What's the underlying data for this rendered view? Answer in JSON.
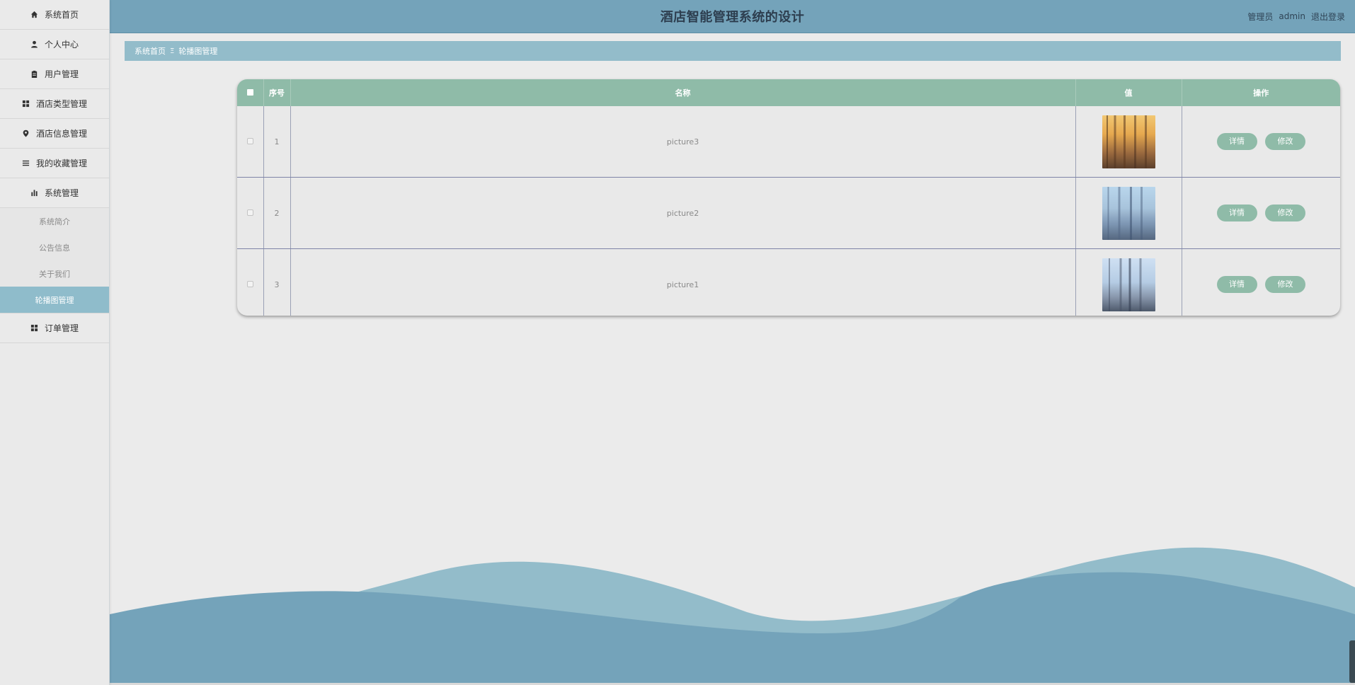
{
  "header": {
    "title": "酒店智能管理系统的设计",
    "user_role": "管理员",
    "username": "admin",
    "logout": "退出登录"
  },
  "sidebar": {
    "items": [
      {
        "label": "系统首页",
        "icon": "home-icon"
      },
      {
        "label": "个人中心",
        "icon": "user-icon"
      },
      {
        "label": "用户管理",
        "icon": "clipboard-icon"
      },
      {
        "label": "酒店类型管理",
        "icon": "grid-icon"
      },
      {
        "label": "酒店信息管理",
        "icon": "location-icon"
      },
      {
        "label": "我的收藏管理",
        "icon": "list-icon"
      },
      {
        "label": "系统管理",
        "icon": "bar-chart-icon"
      }
    ],
    "sub_items": [
      {
        "label": "系统简介"
      },
      {
        "label": "公告信息"
      },
      {
        "label": "关于我们"
      },
      {
        "label": "轮播图管理",
        "active": true
      }
    ],
    "last_item": {
      "label": "订单管理",
      "icon": "grid-icon"
    }
  },
  "breadcrumb": {
    "home": "系统首页",
    "separator": "Ξ",
    "current": "轮播图管理"
  },
  "table": {
    "columns": [
      "序号",
      "名称",
      "值",
      "操作"
    ],
    "rows": [
      {
        "index": "1",
        "name": "picture3",
        "thumb": "city-sunset"
      },
      {
        "index": "2",
        "name": "picture2",
        "thumb": "city-blue"
      },
      {
        "index": "3",
        "name": "picture1",
        "thumb": "city-skyline"
      }
    ],
    "actions": {
      "detail": "详情",
      "edit": "修改"
    }
  },
  "colors": {
    "header_bg": "#74a3ba",
    "breadcrumb_bg": "#93bcca",
    "table_header_bg": "#8fbba8",
    "button_bg": "#8fbba8",
    "active_menu_bg": "#8fbccb",
    "wave_front": "#74a3ba",
    "wave_back": "#93bcca"
  }
}
